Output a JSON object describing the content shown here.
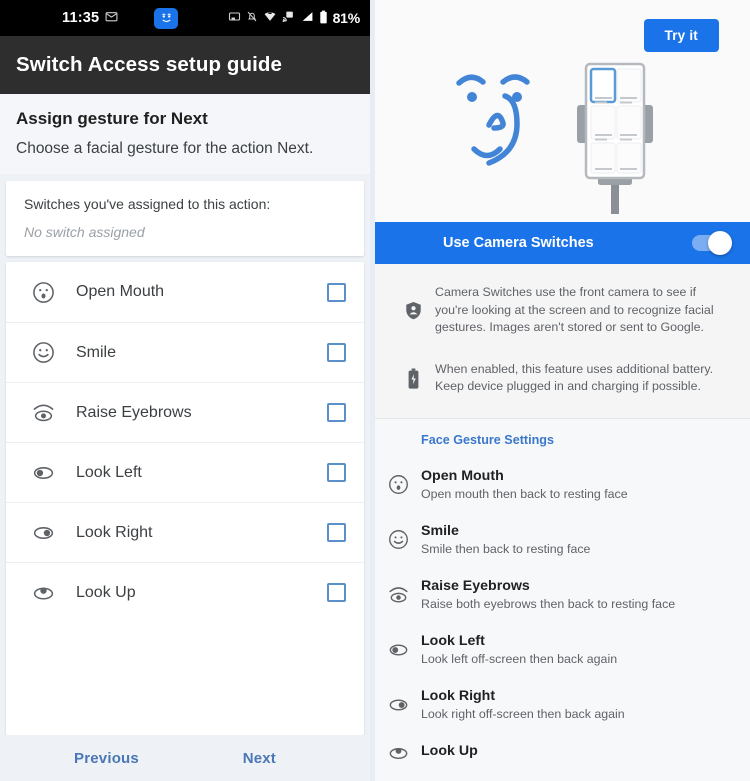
{
  "left": {
    "status_bar": {
      "time": "11:35",
      "icons": [
        "message-icon",
        "camera-switches-face-icon",
        "screenshot-icon",
        "notifications-off-icon",
        "wifi-icon",
        "cast-icon",
        "signal-icon",
        "battery-icon"
      ],
      "battery_percent": "81%"
    },
    "app_bar": {
      "title": "Switch Access setup guide"
    },
    "section": {
      "title": "Assign gesture for Next",
      "subtitle": "Choose a facial gesture for the action Next."
    },
    "assigned": {
      "label": "Switches you've assigned to this action:",
      "value": "No switch assigned"
    },
    "gestures": [
      {
        "icon": "open-mouth-face-icon",
        "label": "Open Mouth",
        "checked": false
      },
      {
        "icon": "smile-face-icon",
        "label": "Smile",
        "checked": false
      },
      {
        "icon": "raise-eyebrows-eye-icon",
        "label": "Raise Eyebrows",
        "checked": false
      },
      {
        "icon": "look-left-eye-icon",
        "label": "Look Left",
        "checked": false
      },
      {
        "icon": "look-right-eye-icon",
        "label": "Look Right",
        "checked": false
      },
      {
        "icon": "look-up-eye-icon",
        "label": "Look Up",
        "checked": false
      }
    ],
    "nav": {
      "previous": "Previous",
      "next": "Next"
    }
  },
  "right": {
    "hero": {
      "try_it_label": "Try it",
      "illustration": "face-and-phone-on-stand-illustration"
    },
    "toggle": {
      "label": "Use Camera Switches",
      "enabled": true
    },
    "info": [
      {
        "icon": "privacy-shield-icon",
        "text": "Camera Switches use the front camera to see if you're looking at the screen and to recognize facial gestures. Images aren't stored or sent to Google."
      },
      {
        "icon": "battery-charging-icon",
        "text": "When enabled, this feature uses additional battery. Keep device plugged in and charging if possible."
      }
    ],
    "settings": {
      "section_title": "Face Gesture Settings",
      "items": [
        {
          "icon": "open-mouth-face-icon",
          "title": "Open Mouth",
          "subtitle": "Open mouth then back to resting face"
        },
        {
          "icon": "smile-face-icon",
          "title": "Smile",
          "subtitle": "Smile then back to resting face"
        },
        {
          "icon": "raise-eyebrows-eye-icon",
          "title": "Raise Eyebrows",
          "subtitle": "Raise both eyebrows then back to resting face"
        },
        {
          "icon": "look-left-eye-icon",
          "title": "Look Left",
          "subtitle": "Look left off-screen then back again"
        },
        {
          "icon": "look-right-eye-icon",
          "title": "Look Right",
          "subtitle": "Look right off-screen then back again"
        },
        {
          "icon": "look-up-eye-icon",
          "title": "Look Up",
          "subtitle": ""
        }
      ]
    }
  },
  "colors": {
    "accent_blue": "#1a73e8",
    "link_blue": "#3b78cc",
    "nav_blue": "#4a77b5",
    "app_bar": "#2e2e2e",
    "page_bg": "#eef1f6"
  }
}
